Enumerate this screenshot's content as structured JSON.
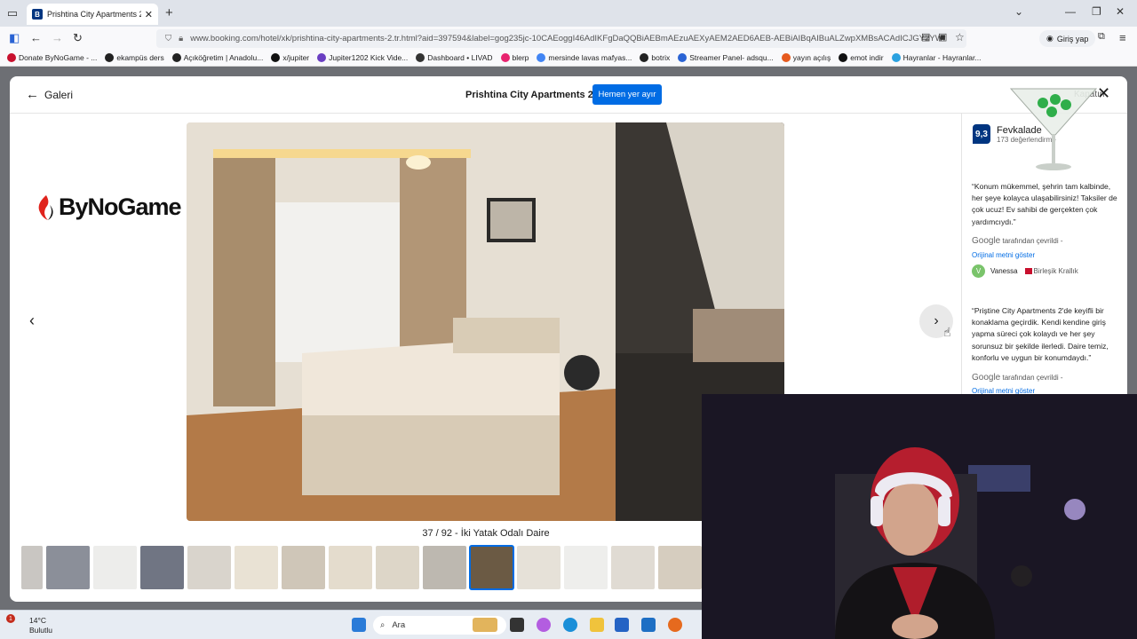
{
  "browser": {
    "tab_title": "Prishtina City Apartments 2, Pri",
    "tab_favicon": "B",
    "url": "www.booking.com/hotel/xk/prishtina-city-apartments-2.tr.html?aid=397594&label=gog235jc-10CAEoggI46AdIKFgDaQQBiAEBmAEzuAEXyAEM2AED6AEB-AEBiAIBqAIBuALZwpXMBsACAdICJGY2YWf",
    "signin_label": "Giriş yap",
    "bookmarks": [
      {
        "label": "Donate ByNoGame - ...",
        "color": "#c8102e"
      },
      {
        "label": "ekampüs ders",
        "color": "#222222"
      },
      {
        "label": "Açıköğretim | Anadolu...",
        "color": "#222222"
      },
      {
        "label": "x/jupiter",
        "color": "#111111"
      },
      {
        "label": "Jupiter1202 Kick Vide...",
        "color": "#6a3ec2"
      },
      {
        "label": "Dashboard • LIVAD",
        "color": "#333333"
      },
      {
        "label": "blerp",
        "color": "#e8236f"
      },
      {
        "label": "mersinde lavas mafyas...",
        "color": "#4285f4"
      },
      {
        "label": "botrix",
        "color": "#222222"
      },
      {
        "label": "Streamer Panel- adsqu...",
        "color": "#2a63d4"
      },
      {
        "label": "yayın açılış",
        "color": "#e65a1e"
      },
      {
        "label": "emot indir",
        "color": "#111111"
      },
      {
        "label": "Hayranlar - Hayranlar...",
        "color": "#2aa1e0"
      }
    ]
  },
  "gallery": {
    "back_label": "Galeri",
    "property_title": "Prishtina City Apartments 2",
    "reserve_label": "Hemen yer ayır",
    "close_label": "Kapatın",
    "caption": "37 / 92 - İki Yatak Odalı Daire",
    "logo_text": "ByNoGame",
    "thumbnail_count": 15,
    "active_thumbnail": 10
  },
  "reviews": {
    "score": "9,3",
    "score_word": "Fevkalade",
    "score_count": "173 değerlendirme",
    "review1": "“Konum mükemmel, şehrin tam kalbinde, her şeye kolayca ulaşabilirsiniz! Taksiler de çok ucuz! Ev sahibi de gerçekten çok yardımcıydı.”",
    "google_word": "Google",
    "translated_suffix": "tarafından çevrildi -",
    "show_original": "Orijinal metni göster",
    "reviewer_initial": "V",
    "reviewer_name": "Vanessa",
    "reviewer_country": "Birleşik Krallık",
    "review2": "“Priştine City Apartments 2'de keyifli bir konaklama geçirdik. Kendi kendine giriş yapma süreci çok kolaydı ve her şey sorunsuz bir şekilde ilerledi. Daire temiz, konforlu ve uygun bir konumdaydı.”",
    "translated_suffix2": "tarafından çevrildi -",
    "show_original2": "Orijinal metni göster"
  },
  "taskbar": {
    "temperature": "14°C",
    "weather": "Bulutlu",
    "badge": "1",
    "search_label": "Ara"
  }
}
